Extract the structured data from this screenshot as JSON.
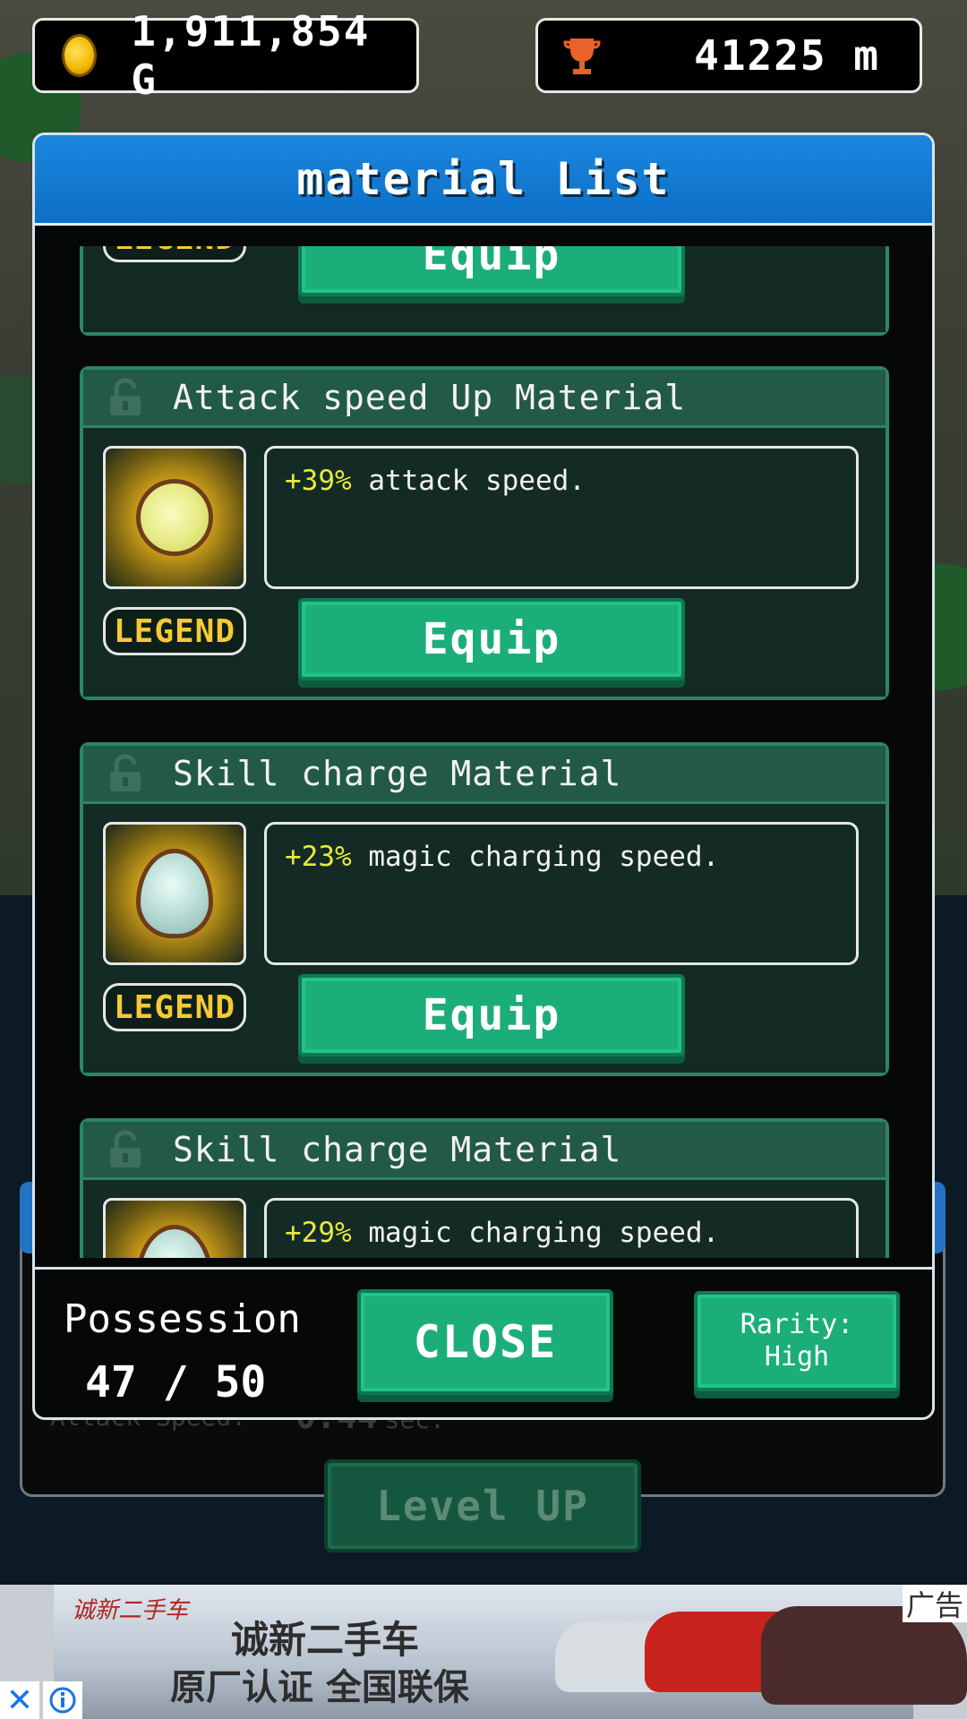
{
  "hud": {
    "gold": "1,911,854 G",
    "distance": "41225 m",
    "icons": {
      "gold": "gold-coin-icon",
      "distance": "trophy-icon"
    }
  },
  "dialog": {
    "title": "material List",
    "items": [
      {
        "rarity": "LEGEND",
        "equip_label": "Equip"
      },
      {
        "name": "Attack speed Up Material",
        "icon": "yellow-orb-icon",
        "desc_pct": "+39%",
        "desc_text": " attack speed.",
        "rarity": "LEGEND",
        "equip_label": "Equip"
      },
      {
        "name": "Skill charge Material",
        "icon": "egg-crystal-icon",
        "desc_pct": "+23%",
        "desc_text": " magic charging speed.",
        "rarity": "LEGEND",
        "equip_label": "Equip"
      },
      {
        "name": "Skill charge Material",
        "icon": "egg-crystal-icon",
        "desc_pct": "+29%",
        "desc_text": " magic charging speed."
      }
    ],
    "footer": {
      "possession_label": "Possession",
      "possession_count": "47 / 50",
      "close_label": "CLOSE",
      "rarity_line1": "Rarity:",
      "rarity_line2": "High"
    }
  },
  "background": {
    "stat_label": "Attack Speed:",
    "stat_value": "0.44",
    "stat_unit": "sec.",
    "level_up_label": "Level UP"
  },
  "ad": {
    "logo": "诚新二手车",
    "headline": "诚新二手车",
    "sub": "原厂认证 全国联保",
    "tag": "广告",
    "close": "✕"
  },
  "colors": {
    "title_bar": "#0c6fc6",
    "button_green": "#1cae79",
    "legend_text": "#f7c933",
    "percent_yellow": "#e9ea3a"
  }
}
